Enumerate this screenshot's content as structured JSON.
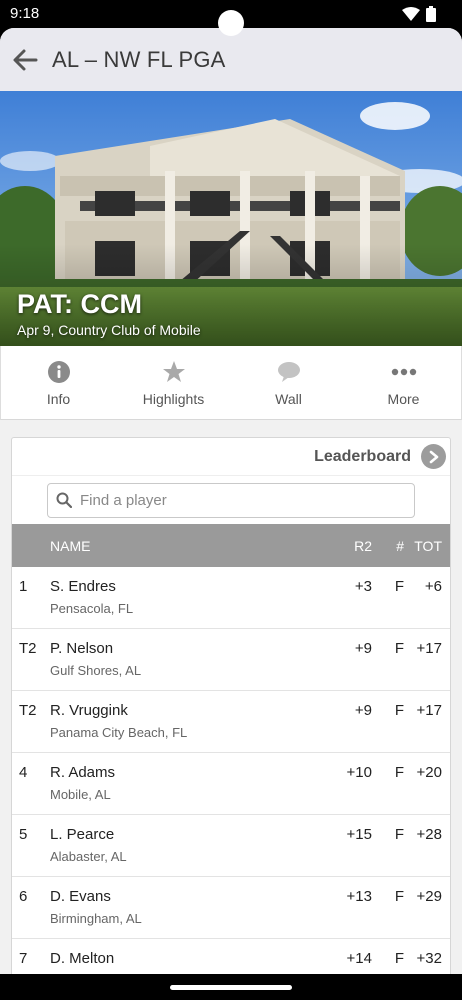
{
  "status": {
    "time": "9:18"
  },
  "app_bar": {
    "title": "AL – NW FL PGA"
  },
  "event": {
    "title": "PAT: CCM",
    "subtitle": "Apr 9, Country Club of Mobile"
  },
  "tabs": [
    {
      "label": "Info",
      "icon": "info-icon"
    },
    {
      "label": "Highlights",
      "icon": "star-icon"
    },
    {
      "label": "Wall",
      "icon": "speech-bubble-icon"
    },
    {
      "label": "More",
      "icon": "more-dots-icon"
    }
  ],
  "leaderboard": {
    "title": "Leaderboard",
    "search_placeholder": "Find a player",
    "columns": {
      "name": "NAME",
      "round": "R2",
      "thru": "#",
      "total": "TOT"
    },
    "rows": [
      {
        "pos": "1",
        "name": "S. Endres",
        "loc": "Pensacola, FL",
        "r2": "+3",
        "thru": "F",
        "tot": "+6"
      },
      {
        "pos": "T2",
        "name": "P. Nelson",
        "loc": "Gulf Shores, AL",
        "r2": "+9",
        "thru": "F",
        "tot": "+17"
      },
      {
        "pos": "T2",
        "name": "R. Vruggink",
        "loc": "Panama City Beach, FL",
        "r2": "+9",
        "thru": "F",
        "tot": "+17"
      },
      {
        "pos": "4",
        "name": "R. Adams",
        "loc": "Mobile, AL",
        "r2": "+10",
        "thru": "F",
        "tot": "+20"
      },
      {
        "pos": "5",
        "name": "L. Pearce",
        "loc": "Alabaster, AL",
        "r2": "+15",
        "thru": "F",
        "tot": "+28"
      },
      {
        "pos": "6",
        "name": "D. Evans",
        "loc": "Birmingham, AL",
        "r2": "+13",
        "thru": "F",
        "tot": "+29"
      },
      {
        "pos": "7",
        "name": "D. Melton",
        "loc": "",
        "r2": "+14",
        "thru": "F",
        "tot": "+32"
      }
    ]
  }
}
